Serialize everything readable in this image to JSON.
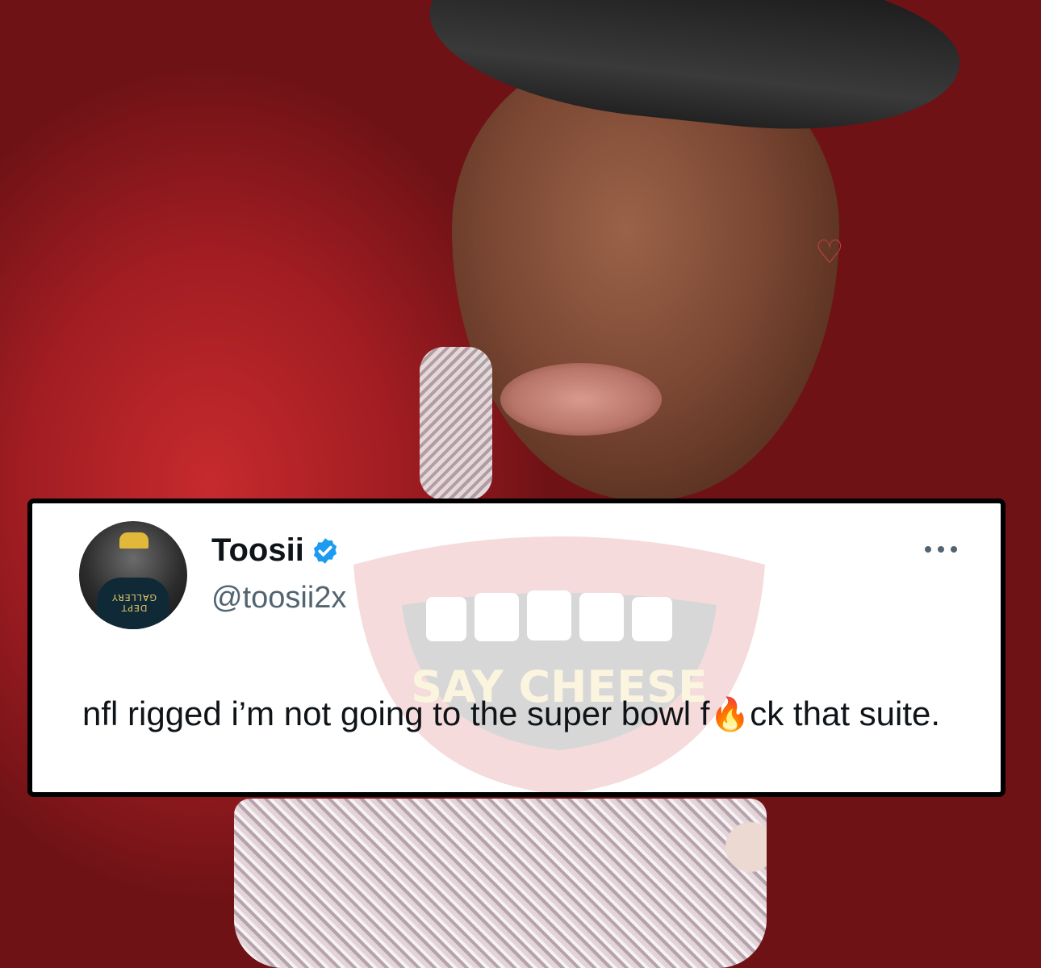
{
  "tweet": {
    "display_name": "Toosii",
    "handle": "@toosii2x",
    "text_before_emoji": "nfl rigged i’m not going to the super bowl f",
    "emoji": "🔥",
    "text_after_emoji": "ck that suite.",
    "verified": true
  },
  "avatar": {
    "shirt_text": "DEPT GALLERY"
  },
  "watermark": {
    "text": "SAY CHEESE"
  },
  "icons": {
    "verified": "verified-badge-icon",
    "more": "more-options-icon",
    "fire": "fire-emoji-icon"
  },
  "colors": {
    "verified_blue": "#1d9bf0",
    "text_primary": "#0f1419",
    "text_secondary": "#536471",
    "watermark_red": "#c62828"
  }
}
